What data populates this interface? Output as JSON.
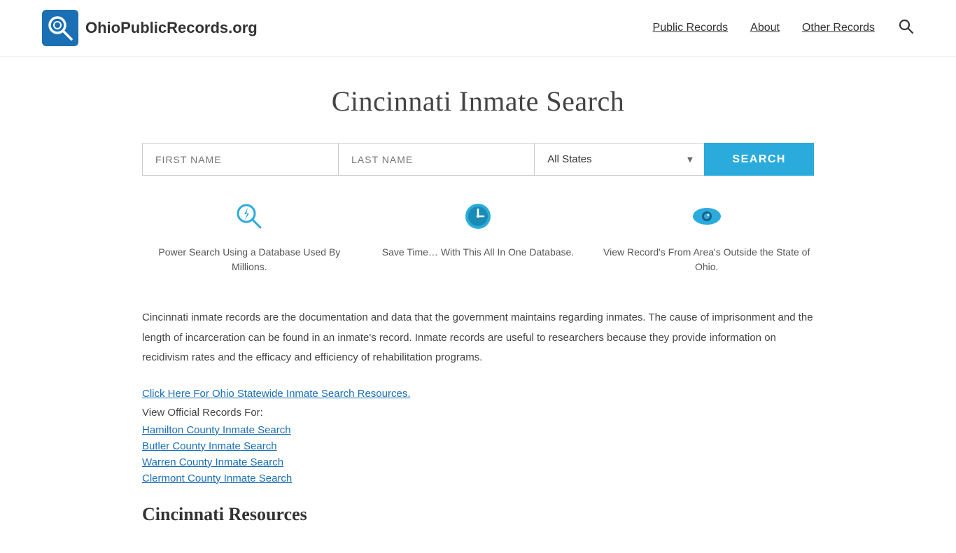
{
  "header": {
    "logo_text_part1": "OhioPublicRecords",
    "logo_text_part2": ".org",
    "nav": {
      "public_records": "Public Records",
      "about": "About",
      "other_records": "Other Records"
    }
  },
  "page": {
    "title": "Cincinnati Inmate Search",
    "search": {
      "first_name_placeholder": "FIRST NAME",
      "last_name_placeholder": "LAST NAME",
      "state_default": "All States",
      "button_label": "SEARCH"
    },
    "features": [
      {
        "icon": "power-search",
        "text": "Power Search Using a Database Used By Millions."
      },
      {
        "icon": "clock",
        "text": "Save Time… With This All In One Database."
      },
      {
        "icon": "eye",
        "text": "View Record's From Area's Outside the State of Ohio."
      }
    ],
    "body_paragraph": "Cincinnati inmate records are the documentation and data that the government maintains regarding inmates. The cause of imprisonment and the length of incarceration can be found in an inmate's record. Inmate records are useful to researchers because they provide information on recidivism rates and the efficacy and efficiency of rehabilitation programs.",
    "statewide_link": "Click Here For Ohio Statewide Inmate Search Resources.",
    "view_label": "View Official Records For:",
    "county_links": [
      "Hamilton County Inmate Search",
      "Butler County Inmate Search",
      "Warren County Inmate Search",
      "Clermont County Inmate Search"
    ],
    "resources_heading": "Cincinnati Resources"
  }
}
